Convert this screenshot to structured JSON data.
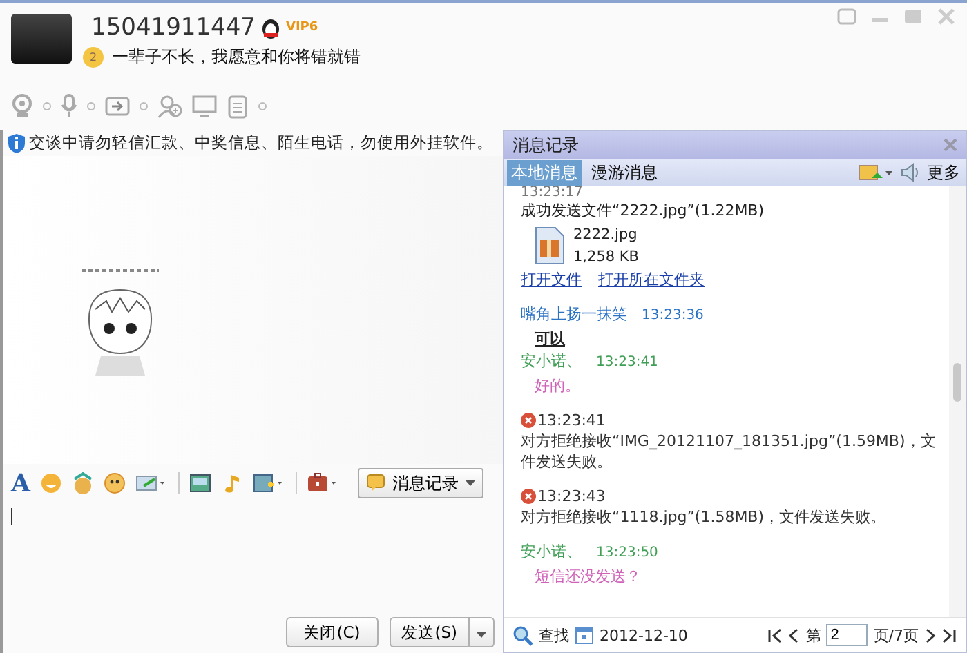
{
  "contact": {
    "name": "15041911447",
    "badge": "VIP6",
    "level": "2",
    "signature": "一辈子不长，我愿意和你将错就错"
  },
  "notice": "交谈中请勿轻信汇款、中奖信息、陌生电话，勿使用外挂软件。",
  "format_toolbar": {
    "font_glyph": "A",
    "history_button": "消息记录"
  },
  "buttons": {
    "close": "关闭(C)",
    "send": "发送(S)"
  },
  "history": {
    "title": "消息记录",
    "tabs": [
      {
        "label": "本地消息",
        "selected": true
      },
      {
        "label": "漫游消息",
        "selected": false
      }
    ],
    "more": "更多",
    "messages": [
      {
        "kind": "time",
        "time": "13:23:17"
      },
      {
        "kind": "text",
        "text": "成功发送文件“2222.jpg”(1.22MB)"
      },
      {
        "kind": "file",
        "name": "2222.jpg",
        "size": "1,258 KB"
      },
      {
        "kind": "links",
        "links": [
          "打开文件",
          "打开所在文件夹"
        ]
      },
      {
        "kind": "sender",
        "name": "嘴角上扬一抹笑",
        "time": "13:23:36",
        "color": "#2a72c4"
      },
      {
        "kind": "bold-message",
        "text": "可以"
      },
      {
        "kind": "sender",
        "name": "安小诺、",
        "time": "13:23:41",
        "color": "#3f9f55"
      },
      {
        "kind": "message",
        "text": "好的。",
        "color": "#d062b8"
      },
      {
        "kind": "error",
        "time": "13:23:41",
        "text": "对方拒绝接收“IMG_20121107_181351.jpg”(1.59MB)，文件发送失败。"
      },
      {
        "kind": "error",
        "time": "13:23:43",
        "text": "对方拒绝接收“1118.jpg”(1.58MB)，文件发送失败。"
      },
      {
        "kind": "sender",
        "name": "安小诺、",
        "time": "13:23:50",
        "color": "#3f9f55"
      },
      {
        "kind": "message",
        "text": "短信还没发送？",
        "color": "#d062b8"
      }
    ],
    "footer": {
      "search": "查找",
      "date": "2012-12-10",
      "page_prefix": "第",
      "page": "2",
      "page_suffix": "页/7页"
    }
  }
}
